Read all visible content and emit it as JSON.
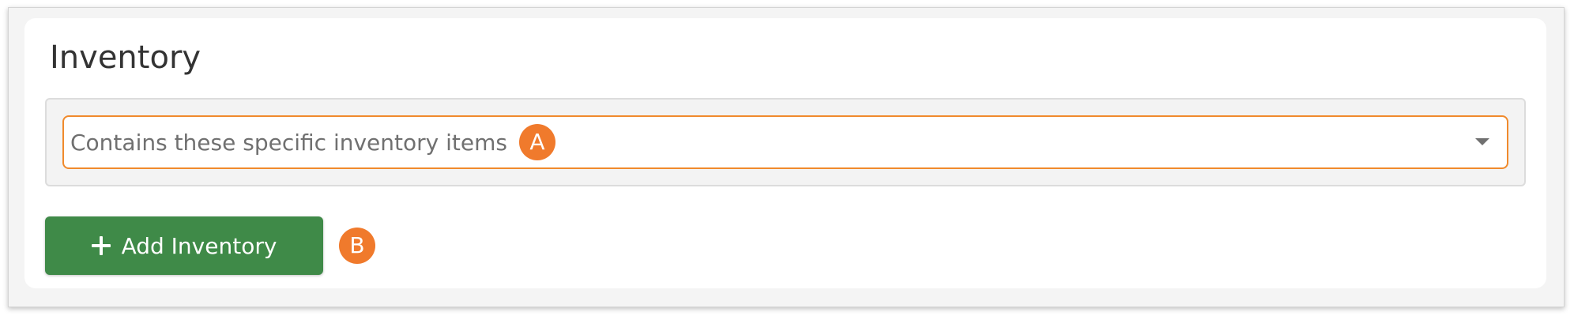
{
  "section": {
    "title": "Inventory"
  },
  "filter": {
    "select_value": "Contains these specific inventory items",
    "caret_icon": "caret-down-icon"
  },
  "actions": {
    "add_label": "Add Inventory",
    "add_icon": "plus-icon"
  },
  "annotations": {
    "a": "A",
    "b": "B"
  },
  "colors": {
    "accent_orange": "#f07a2c",
    "select_border": "#f08a2c",
    "button_green": "#3f8a48"
  }
}
